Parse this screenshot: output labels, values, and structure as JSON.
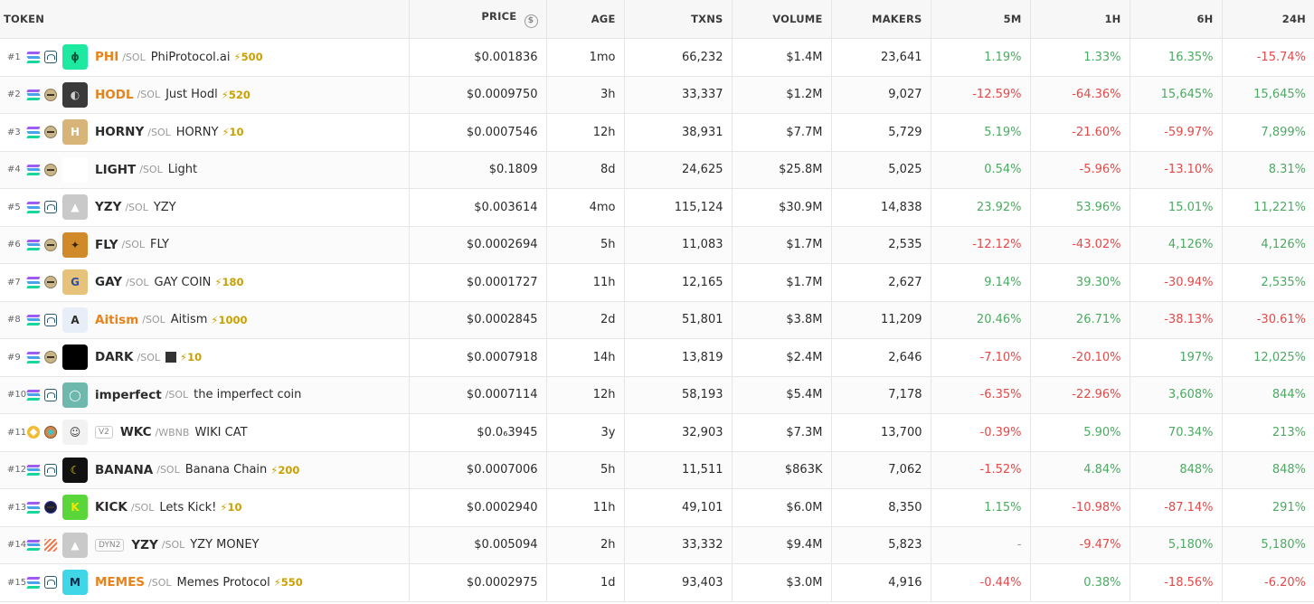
{
  "headers": [
    "TOKEN",
    "PRICE",
    "AGE",
    "TXNS",
    "VOLUME",
    "MAKERS",
    "5M",
    "1H",
    "6H",
    "24H"
  ],
  "rows": [
    {
      "rank": "#1",
      "sym": "PHI",
      "hot": true,
      "quote": "/SOL",
      "name": "PhiProtocol.ai",
      "boost": "⚡500",
      "price": "$0.001836",
      "age": "1mo",
      "txns": "66,232",
      "volume": "$1.4M",
      "makers": "23,641",
      "m5": "1.19%",
      "h1": "1.33%",
      "h6": "16.35%",
      "h24": "-15.74%",
      "dex": "raydium",
      "logo_bg": "#1de9a0",
      "logo_fg": "#0a5a3a",
      "logo_txt": "ϕ"
    },
    {
      "rank": "#2",
      "sym": "HODL",
      "hot": true,
      "quote": "/SOL",
      "name": "Just Hodl",
      "boost": "⚡520",
      "price": "$0.0009750",
      "age": "3h",
      "txns": "33,337",
      "volume": "$1.2M",
      "makers": "9,027",
      "m5": "-12.59%",
      "h1": "-64.36%",
      "h6": "15,645%",
      "h24": "15,645%",
      "dex": "pump",
      "logo_bg": "#3a3a3a",
      "logo_fg": "#cfcfcf",
      "logo_txt": "◐"
    },
    {
      "rank": "#3",
      "sym": "HORNY",
      "hot": false,
      "quote": "/SOL",
      "name": "HORNY",
      "boost": "⚡10",
      "price": "$0.0007546",
      "age": "12h",
      "txns": "38,931",
      "volume": "$7.7M",
      "makers": "5,729",
      "m5": "5.19%",
      "h1": "-21.60%",
      "h6": "-59.97%",
      "h24": "7,899%",
      "dex": "pump",
      "logo_bg": "#d8b478",
      "logo_fg": "#fff",
      "logo_txt": "H"
    },
    {
      "rank": "#4",
      "sym": "LIGHT",
      "hot": false,
      "quote": "/SOL",
      "name": "Light",
      "boost": "",
      "price": "$0.1809",
      "age": "8d",
      "txns": "24,625",
      "volume": "$25.8M",
      "makers": "5,025",
      "m5": "0.54%",
      "h1": "-5.96%",
      "h6": "-13.10%",
      "h24": "8.31%",
      "dex": "pump",
      "logo_bg": "#ffffff",
      "logo_fg": "#ffffff",
      "logo_txt": ""
    },
    {
      "rank": "#5",
      "sym": "YZY",
      "hot": false,
      "quote": "/SOL",
      "name": "YZY",
      "boost": "",
      "price": "$0.003614",
      "age": "4mo",
      "txns": "115,124",
      "volume": "$30.9M",
      "makers": "14,838",
      "m5": "23.92%",
      "h1": "53.96%",
      "h6": "15.01%",
      "h24": "11,221%",
      "dex": "raydium",
      "logo_bg": "#c9c9c9",
      "logo_fg": "#ffffff",
      "logo_txt": "▲"
    },
    {
      "rank": "#6",
      "sym": "FLY",
      "hot": false,
      "quote": "/SOL",
      "name": "FLY",
      "boost": "",
      "price": "$0.0002694",
      "age": "5h",
      "txns": "11,083",
      "volume": "$1.7M",
      "makers": "2,535",
      "m5": "-12.12%",
      "h1": "-43.02%",
      "h6": "4,126%",
      "h24": "4,126%",
      "dex": "pump",
      "logo_bg": "#d08a2a",
      "logo_fg": "#3a2508",
      "logo_txt": "✦"
    },
    {
      "rank": "#7",
      "sym": "GAY",
      "hot": false,
      "quote": "/SOL",
      "name": "GAY COIN",
      "boost": "⚡180",
      "price": "$0.0001727",
      "age": "11h",
      "txns": "12,165",
      "volume": "$1.7M",
      "makers": "2,627",
      "m5": "9.14%",
      "h1": "39.30%",
      "h6": "-30.94%",
      "h24": "2,535%",
      "dex": "pump",
      "logo_bg": "#e6c27a",
      "logo_fg": "#2f4f9a",
      "logo_txt": "G"
    },
    {
      "rank": "#8",
      "sym": "Aitism",
      "hot": true,
      "quote": "/SOL",
      "name": "Aitism",
      "boost": "⚡1000",
      "price": "$0.0002845",
      "age": "2d",
      "txns": "51,801",
      "volume": "$3.8M",
      "makers": "11,209",
      "m5": "20.46%",
      "h1": "26.71%",
      "h6": "-38.13%",
      "h24": "-30.61%",
      "dex": "raydium",
      "logo_bg": "#e8eef8",
      "logo_fg": "#2b2b2b",
      "logo_txt": "A"
    },
    {
      "rank": "#9",
      "sym": "DARK",
      "hot": false,
      "quote": "/SOL",
      "name": "",
      "boost": "⚡10",
      "price": "$0.0007918",
      "age": "14h",
      "txns": "13,819",
      "volume": "$2.4M",
      "makers": "2,646",
      "m5": "-7.10%",
      "h1": "-20.10%",
      "h6": "197%",
      "h24": "12,025%",
      "dex": "pump",
      "logo_bg": "#000000",
      "logo_fg": "#000000",
      "logo_txt": ""
    },
    {
      "rank": "#10",
      "sym": "imperfect",
      "hot": false,
      "quote": "/SOL",
      "name": "the imperfect coin",
      "boost": "",
      "price": "$0.0007114",
      "age": "12h",
      "txns": "58,193",
      "volume": "$5.4M",
      "makers": "7,178",
      "m5": "-6.35%",
      "h1": "-22.96%",
      "h6": "3,608%",
      "h24": "844%",
      "dex": "raydium",
      "logo_bg": "#6fb8ad",
      "logo_fg": "#ffffff",
      "logo_txt": "◯"
    },
    {
      "rank": "#11",
      "sym": "WKC",
      "hot": false,
      "quote": "/WBNB",
      "name": "WIKI CAT",
      "boost": "",
      "version": "V2",
      "price": "$0.0₆3945",
      "age": "3y",
      "txns": "32,903",
      "volume": "$7.3M",
      "makers": "13,700",
      "m5": "-0.39%",
      "h1": "5.90%",
      "h6": "70.34%",
      "h24": "213%",
      "dex": "pancake",
      "chain": "bnb",
      "logo_bg": "#f2f2f2",
      "logo_fg": "#333333",
      "logo_txt": "☺"
    },
    {
      "rank": "#12",
      "sym": "BANANA",
      "hot": false,
      "quote": "/SOL",
      "name": "Banana Chain",
      "boost": "⚡200",
      "price": "$0.0007006",
      "age": "5h",
      "txns": "11,511",
      "volume": "$863K",
      "makers": "7,062",
      "m5": "-1.52%",
      "h1": "4.84%",
      "h6": "848%",
      "h24": "848%",
      "dex": "raydium",
      "logo_bg": "#111111",
      "logo_fg": "#f5d400",
      "logo_txt": "☾"
    },
    {
      "rank": "#13",
      "sym": "KICK",
      "hot": false,
      "quote": "/SOL",
      "name": "Lets Kick!",
      "boost": "⚡10",
      "price": "$0.0002940",
      "age": "11h",
      "txns": "49,101",
      "volume": "$6.0M",
      "makers": "8,350",
      "m5": "1.15%",
      "h1": "-10.98%",
      "h6": "-87.14%",
      "h24": "291%",
      "dex": "dark",
      "logo_bg": "#5ad63a",
      "logo_fg": "#f5e400",
      "logo_txt": "K"
    },
    {
      "rank": "#14",
      "sym": "YZY",
      "hot": false,
      "quote": "/SOL",
      "name": "YZY MONEY",
      "boost": "",
      "version": "DYN2",
      "price": "$0.005094",
      "age": "2h",
      "txns": "33,332",
      "volume": "$9.4M",
      "makers": "5,823",
      "m5": "-",
      "h1": "-9.47%",
      "h6": "5,180%",
      "h24": "5,180%",
      "dex": "meteora",
      "logo_bg": "#c9c9c9",
      "logo_fg": "#ffffff",
      "logo_txt": "▲"
    },
    {
      "rank": "#15",
      "sym": "MEMES",
      "hot": true,
      "quote": "/SOL",
      "name": "Memes Protocol",
      "boost": "⚡550",
      "price": "$0.0002975",
      "age": "1d",
      "txns": "93,403",
      "volume": "$3.0M",
      "makers": "4,916",
      "m5": "-0.44%",
      "h1": "0.38%",
      "h6": "-18.56%",
      "h24": "-6.20%",
      "dex": "raydium",
      "logo_bg": "#3fd6e8",
      "logo_fg": "#0a2a4a",
      "logo_txt": "M"
    }
  ]
}
